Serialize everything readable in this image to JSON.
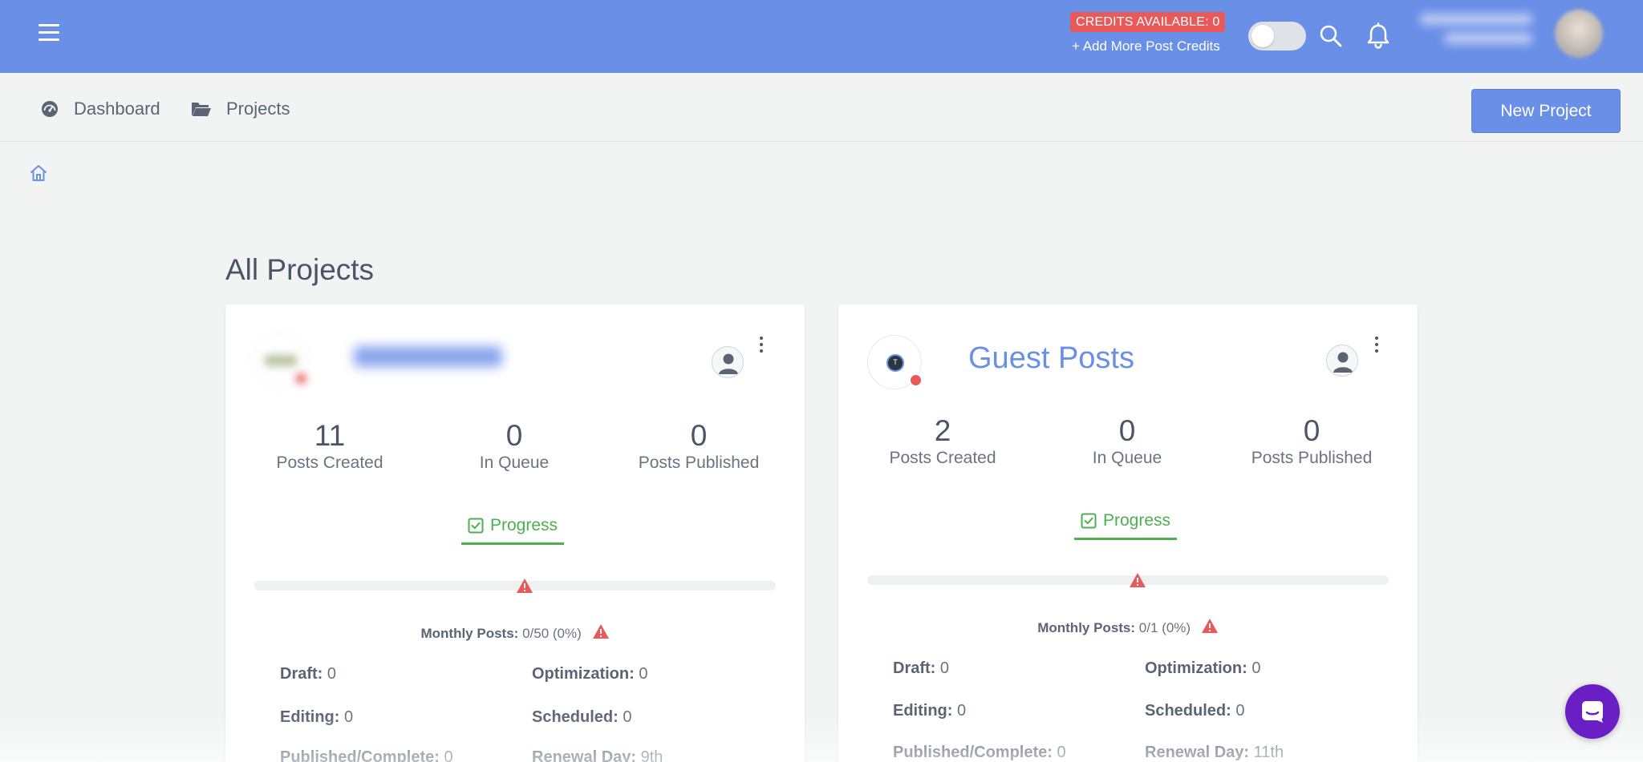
{
  "header": {
    "credits_badge": "CREDITS AVAILABLE: 0",
    "add_credits_link": "+ Add More Post Credits",
    "toggle_state": "off",
    "accent_color": "#6a8fe6",
    "badge_color": "#e85a5a"
  },
  "subnav": {
    "dashboard_label": "Dashboard",
    "projects_label": "Projects",
    "new_project_label": "New Project"
  },
  "page": {
    "title": "All Projects"
  },
  "projects": [
    {
      "title": "",
      "title_redacted": true,
      "stats": {
        "posts_created": "11",
        "posts_created_label": "Posts Created",
        "in_queue": "0",
        "in_queue_label": "In Queue",
        "posts_published": "0",
        "posts_published_label": "Posts Published"
      },
      "progress_tab_label": "Progress",
      "monthly_label": "Monthly Posts:",
      "monthly_value": "0/50 (0%)",
      "monthly_fraction": 0.0,
      "draft_label": "Draft:",
      "draft_value": "0",
      "optimization_label": "Optimization:",
      "optimization_value": "0",
      "editing_label": "Editing:",
      "editing_value": "0",
      "scheduled_label": "Scheduled:",
      "scheduled_value": "0",
      "published_label": "Published/Complete:",
      "published_value": "0",
      "renewal_label": "Renewal Day:",
      "renewal_value": "9th"
    },
    {
      "title": "Guest Posts",
      "title_redacted": false,
      "stats": {
        "posts_created": "2",
        "posts_created_label": "Posts Created",
        "in_queue": "0",
        "in_queue_label": "In Queue",
        "posts_published": "0",
        "posts_published_label": "Posts Published"
      },
      "progress_tab_label": "Progress",
      "monthly_label": "Monthly Posts:",
      "monthly_value": "0/1 (0%)",
      "monthly_fraction": 0.0,
      "draft_label": "Draft:",
      "draft_value": "0",
      "optimization_label": "Optimization:",
      "optimization_value": "0",
      "editing_label": "Editing:",
      "editing_value": "0",
      "scheduled_label": "Scheduled:",
      "scheduled_value": "0",
      "published_label": "Published/Complete:",
      "published_value": "0",
      "renewal_label": "Renewal Day:",
      "renewal_value": "11th"
    }
  ],
  "icons": [
    "menu-icon",
    "search-icon",
    "bell-icon",
    "dashboard-icon",
    "folder-icon",
    "home-icon",
    "user-icon",
    "kebab-icon",
    "checkbox-icon",
    "warning-icon",
    "chat-icon"
  ]
}
